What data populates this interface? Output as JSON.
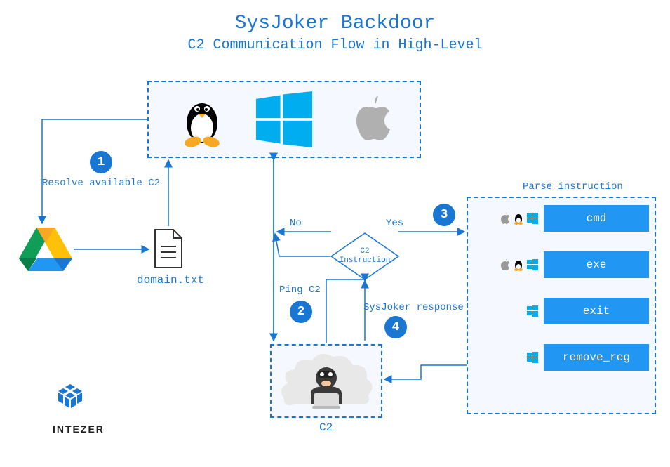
{
  "title": "SysJoker Backdoor",
  "subtitle": "C2 Communication Flow in High-Level",
  "steps": {
    "1": {
      "num": "1",
      "label": "Resolve available C2"
    },
    "2": {
      "num": "2",
      "label": "Ping C2"
    },
    "3": {
      "num": "3",
      "label": ""
    },
    "4": {
      "num": "4",
      "label": "SysJoker response"
    }
  },
  "decision": {
    "label_top": "C2",
    "label_bottom": "Instruction",
    "no": "No",
    "yes": "Yes"
  },
  "domain_file": "domain.txt",
  "c2_label": "C2",
  "parse": {
    "title": "Parse instruction",
    "commands": [
      {
        "name": "cmd",
        "platforms": [
          "apple",
          "linux",
          "windows"
        ]
      },
      {
        "name": "exe",
        "platforms": [
          "apple",
          "linux",
          "windows"
        ]
      },
      {
        "name": "exit",
        "platforms": [
          "windows"
        ]
      },
      {
        "name": "remove_reg",
        "platforms": [
          "windows"
        ]
      }
    ]
  },
  "logo": "INTEZER"
}
